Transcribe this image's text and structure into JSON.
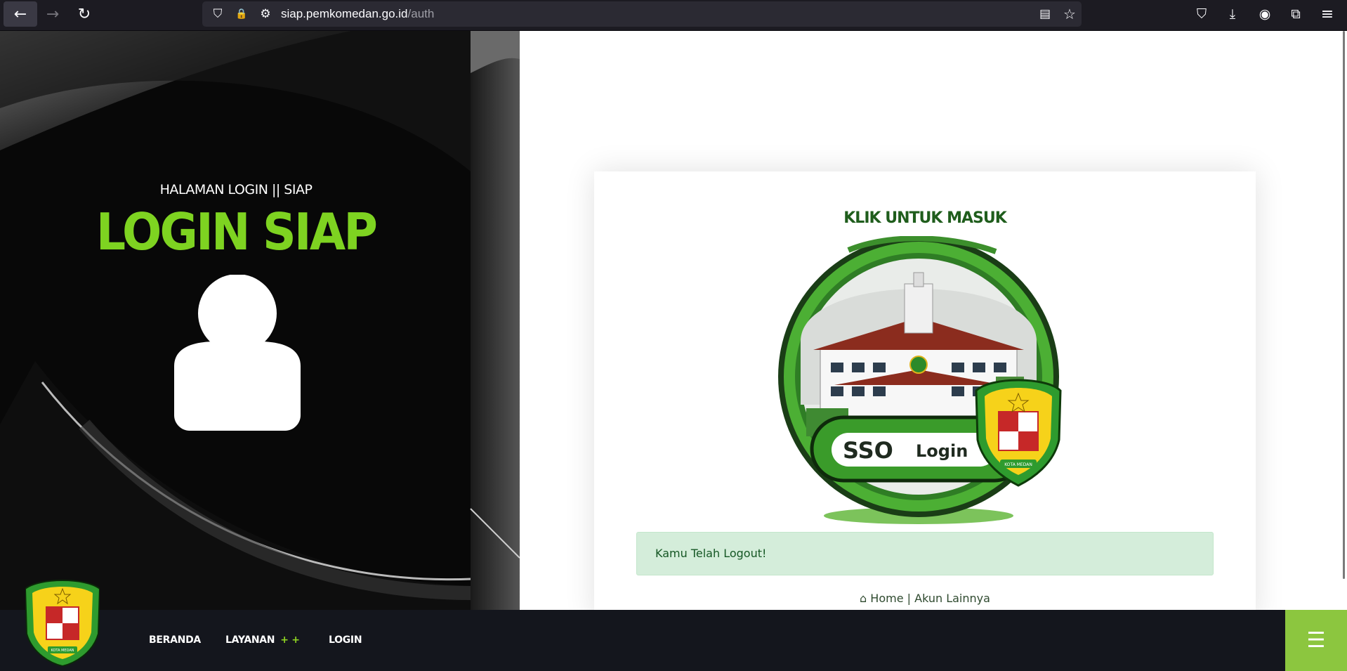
{
  "browser": {
    "url_host": "siap.pemkomedan.go.id",
    "url_path": "/auth",
    "back_icon": "←",
    "forward_icon": "→",
    "reload_icon": "↻",
    "shield_icon": "⛉",
    "lock_icon": "🔒",
    "tracking_icon": "⚙",
    "reader_icon": "▤",
    "star_icon": "☆",
    "pocket_icon": "⛉",
    "download_icon": "⤓",
    "account_icon": "◉",
    "extensions_icon": "⧉",
    "menu_icon": "≡"
  },
  "hero": {
    "subtitle": "HALAMAN LOGIN || SIAP",
    "title": "LOGIN SIAP",
    "accent": "#7ed321"
  },
  "card": {
    "title": "KLIK UNTUK MASUK",
    "sso_word1": "SSO",
    "sso_word2": "Login",
    "seal_text": "KOTA MEDAN",
    "alert": "Kamu Telah Logout!",
    "home_link": "Home",
    "separator": "|",
    "other_accounts_link": "Akun Lainnya",
    "home_icon": "⌂"
  },
  "bottom_nav": {
    "items": [
      {
        "label": "BERANDA"
      },
      {
        "label": "LAYANAN",
        "plus": "+ +"
      },
      {
        "label": "LOGIN"
      }
    ],
    "menu_icon": "☰",
    "accent": "#8cc63f"
  }
}
